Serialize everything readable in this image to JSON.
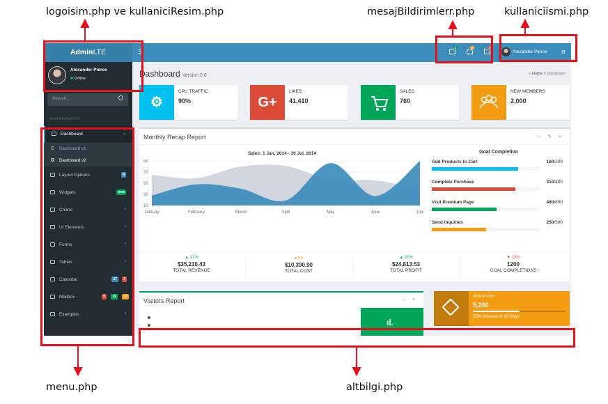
{
  "annotations": {
    "logo_user": "logoisim.php ve kullaniciResim.php",
    "notifications": "mesajBildirimlerr.php",
    "username": "kullaniciismi.php",
    "menu": "menu.php",
    "footer": "altbilgi.php"
  },
  "logo": {
    "bold": "Admin",
    "light": "LTE"
  },
  "user_panel": {
    "name": "Alexander Pierce",
    "status": "Online"
  },
  "search": {
    "placeholder": "Search..."
  },
  "sidebar": {
    "header": "MAIN NAVIGATION",
    "items": [
      {
        "label": "Dashboard",
        "icon": "dashboard-icon",
        "chevron": "⌄"
      },
      {
        "label": "Layout Options",
        "icon": "files-icon",
        "badge": "4",
        "badge_color": "#3c8dbc"
      },
      {
        "label": "Widgets",
        "icon": "th-icon",
        "badge": "new",
        "badge_color": "#00a65a"
      },
      {
        "label": "Charts",
        "icon": "pie-chart-icon",
        "chevron": "‹"
      },
      {
        "label": "UI Elements",
        "icon": "laptop-icon",
        "chevron": "‹"
      },
      {
        "label": "Forms",
        "icon": "edit-icon",
        "chevron": "‹"
      },
      {
        "label": "Tables",
        "icon": "table-icon",
        "chevron": "‹"
      },
      {
        "label": "Calendar",
        "icon": "calendar-icon",
        "badges": [
          "17",
          "3"
        ],
        "badge_colors": [
          "#3c8dbc",
          "#dd4b39"
        ]
      },
      {
        "label": "Mailbox",
        "icon": "envelope-icon",
        "badges": [
          "5",
          "16",
          "12"
        ],
        "badge_colors": [
          "#dd4b39",
          "#00a65a",
          "#f39c12"
        ]
      },
      {
        "label": "Examples",
        "icon": "folder-icon",
        "chevron": "‹"
      }
    ],
    "subitems": [
      "Dashboard v1",
      "Dashboard v2"
    ]
  },
  "header": {
    "toggle": "☰",
    "messages_badge": "4",
    "notifications_badge": "10",
    "tasks_badge": "9",
    "user_name": "Alexander Pierce",
    "gear": "⚙"
  },
  "page": {
    "title": "Dashboard",
    "version": "Version 2.0",
    "breadcrumb_home": "Home",
    "breadcrumb_current": "Dashboard"
  },
  "info_boxes": [
    {
      "label": "CPU TRAFFIC",
      "value": "90%",
      "color": "#00c0ef",
      "icon": "gear-icon"
    },
    {
      "label": "LIKES",
      "value": "41,410",
      "color": "#dd4b39",
      "icon": "google-plus-icon",
      "glyph": "G+"
    },
    {
      "label": "SALES",
      "value": "760",
      "color": "#00a65a",
      "icon": "shopping-cart-icon"
    },
    {
      "label": "NEW MEMBERS",
      "value": "2,000",
      "color": "#f39c12",
      "icon": "users-icon"
    }
  ],
  "recap": {
    "title": "Monthly Recap Report",
    "tools": "– ✎ ×",
    "goal_title": "Goal Completion",
    "goals": [
      {
        "label": "Add Products to Cart",
        "value": "160",
        "total": "/200",
        "fraction": 0.8,
        "color": "#00c0ef"
      },
      {
        "label": "Complete Purchase",
        "value": "310",
        "total": "/400",
        "fraction": 0.775,
        "color": "#dd4b39"
      },
      {
        "label": "Visit Premium Page",
        "value": "480",
        "total": "/800",
        "fraction": 0.6,
        "color": "#00a65a"
      },
      {
        "label": "Send Inquiries",
        "value": "250",
        "total": "/500",
        "fraction": 0.5,
        "color": "#f39c12"
      }
    ],
    "stats": [
      {
        "pct": "▲ 17%",
        "pct_color": "#00a65a",
        "value": "$35,210.43",
        "label": "TOTAL REVENUE"
      },
      {
        "pct": "◂ 0%",
        "pct_color": "#f39c12",
        "value": "$10,390.90",
        "label": "TOTAL COST"
      },
      {
        "pct": "▲ 20%",
        "pct_color": "#00a65a",
        "value": "$24,813.53",
        "label": "TOTAL PROFIT"
      },
      {
        "pct": "▼ 18%",
        "pct_color": "#dd4b39",
        "value": "1200",
        "label": "GOAL COMPLETIONS"
      }
    ]
  },
  "chart_data": {
    "type": "area",
    "title": "Sales: 1 Jan, 2014 - 30 Jul, 2014",
    "categories": [
      "January",
      "February",
      "March",
      "April",
      "May",
      "June",
      "July"
    ],
    "ylim": [
      10,
      90
    ],
    "yticks": [
      90,
      70,
      50,
      30,
      10
    ],
    "series": [
      {
        "name": "",
        "color": "#d2d6de",
        "values": [
          65,
          59,
          80,
          81,
          56,
          55,
          40
        ]
      },
      {
        "name": "",
        "color": "#3c8dbc",
        "values": [
          28,
          48,
          40,
          19,
          86,
          27,
          90
        ]
      }
    ]
  },
  "visitors": {
    "title": "Visitors Report",
    "tools": "– ×"
  },
  "inventory": {
    "title": "INVENTORY",
    "value": "5,200",
    "progress": 0.5,
    "desc": "50% Increase in 30 Days"
  }
}
